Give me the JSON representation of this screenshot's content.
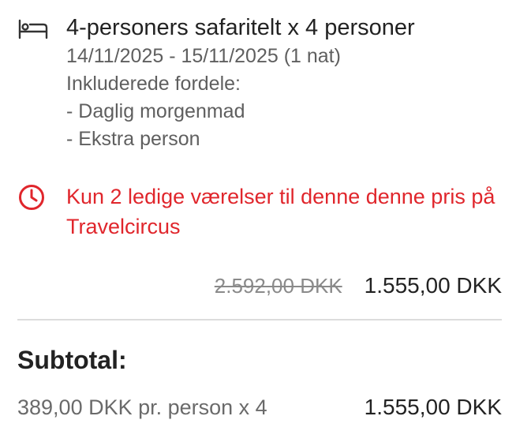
{
  "room": {
    "icon": "bed-icon",
    "title": "4-personers safaritelt x 4 personer",
    "dates": "14/11/2025 - 15/11/2025 (1 nat)",
    "included_heading": "Inkluderede fordele:",
    "benefits": [
      "- Daglig morgenmad",
      "- Ekstra person"
    ]
  },
  "availability": {
    "icon": "clock-icon",
    "text": "Kun 2 ledige værelser til denne denne pris på Travelcircus",
    "color": "#e0262c"
  },
  "price": {
    "original": "2.592,00 DKK",
    "discounted": "1.555,00 DKK"
  },
  "subtotal": {
    "label": "Subtotal:",
    "per_person": "389,00 DKK pr. person x 4",
    "value": "1.555,00 DKK"
  }
}
